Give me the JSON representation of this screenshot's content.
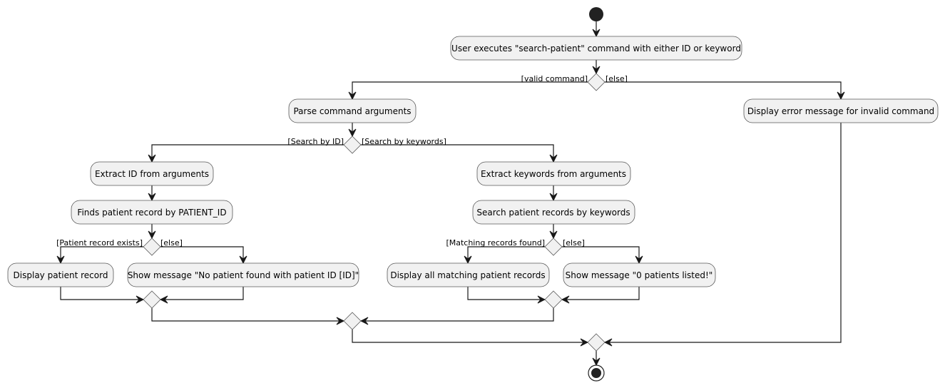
{
  "diagram": {
    "type": "activity",
    "actions": {
      "user_executes": "User executes \"search-patient\" command with either ID or keyword",
      "parse_args": "Parse command arguments",
      "display_error": "Display error message for invalid command",
      "extract_id": "Extract ID from arguments",
      "find_by_id": "Finds patient record by PATIENT_ID",
      "display_record": "Display patient record",
      "no_patient_msg": "Show message \"No patient found with patient ID [ID]\"",
      "extract_keywords": "Extract keywords from arguments",
      "search_keywords": "Search patient records by keywords",
      "display_all_matching": "Display all matching patient records",
      "zero_patients_msg": "Show message \"0 patients listed!\""
    },
    "guards": {
      "valid_command": "[valid command]",
      "else_1": "[else]",
      "search_by_id": "[Search by ID]",
      "search_by_keywords": "[Search by keywords]",
      "record_exists": "[Patient record exists]",
      "else_2": "[else]",
      "matching_found": "[Matching records found]",
      "else_3": "[else]"
    }
  }
}
